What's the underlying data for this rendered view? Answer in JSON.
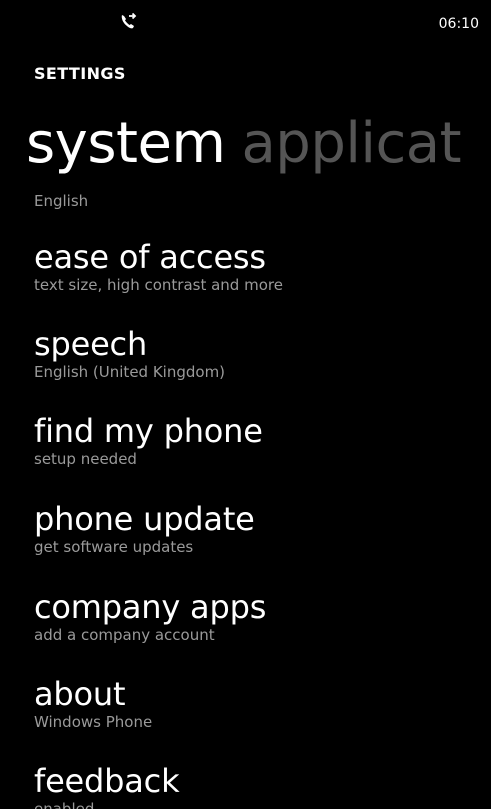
{
  "status_bar": {
    "icon": "call-forwarding-icon",
    "time": "06:10"
  },
  "header": {
    "app_title": "SETTINGS",
    "pivot_active": "system",
    "pivot_next": "applicat"
  },
  "list": {
    "partial_top": "English",
    "items": [
      {
        "title": "ease of access",
        "subtitle": "text size, high contrast and more"
      },
      {
        "title": "speech",
        "subtitle": "English (United Kingdom)"
      },
      {
        "title": "find my phone",
        "subtitle": "setup needed"
      },
      {
        "title": "phone update",
        "subtitle": "get software updates"
      },
      {
        "title": "company apps",
        "subtitle": "add a company account"
      },
      {
        "title": "about",
        "subtitle": "Windows Phone"
      },
      {
        "title": "feedback",
        "subtitle": "enabled"
      }
    ]
  }
}
